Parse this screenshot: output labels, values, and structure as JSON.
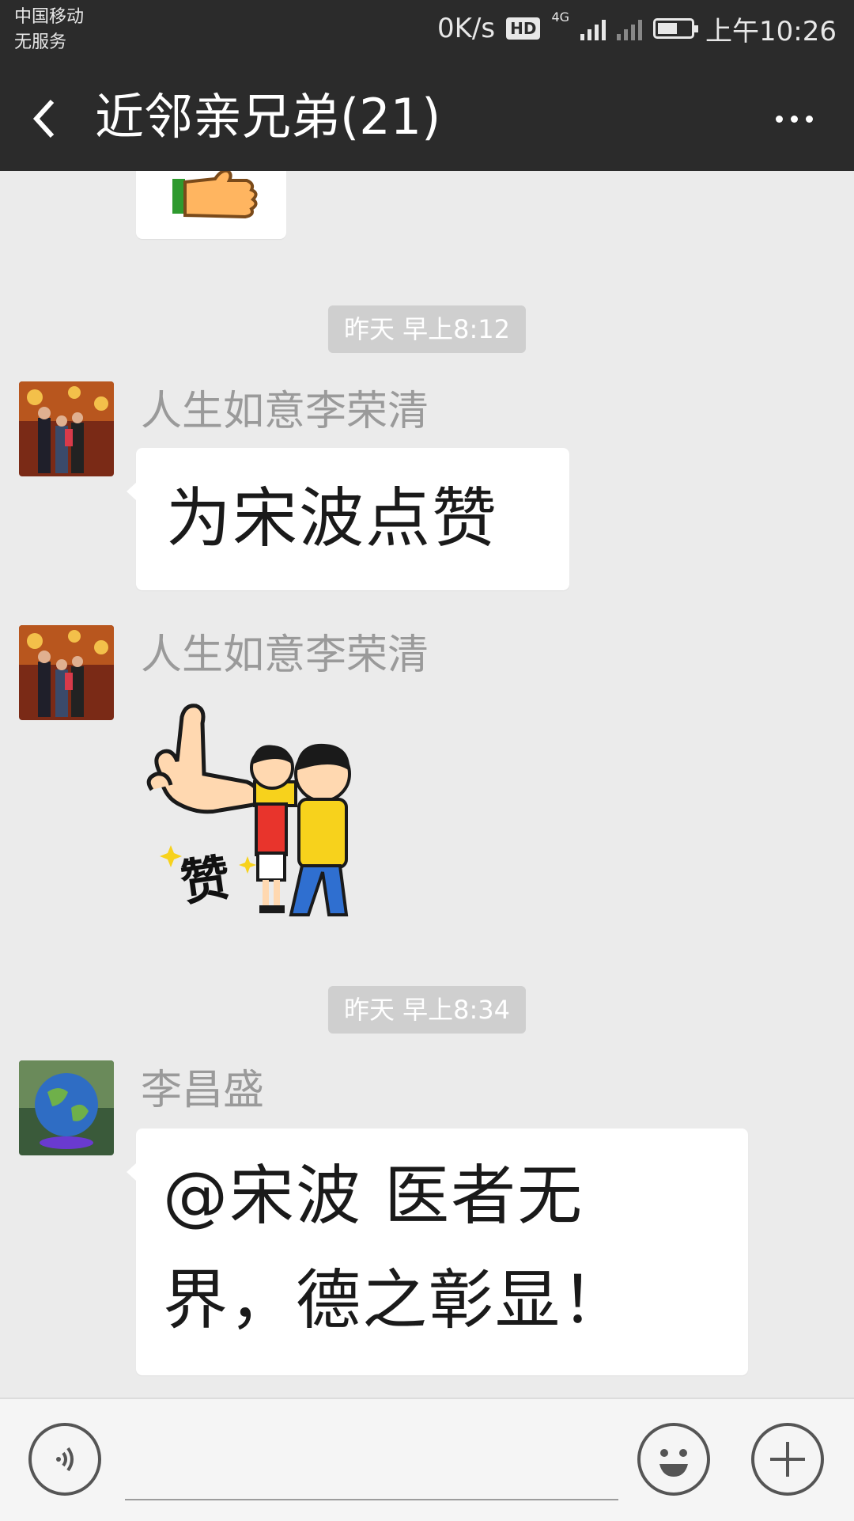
{
  "status_bar": {
    "carrier_line1": "中国移动",
    "carrier_line2": "无服务",
    "speed": "0K/s",
    "hd_badge": "HD",
    "network": "4G",
    "time": "上午10:26"
  },
  "header": {
    "title": "近邻亲兄弟(21)"
  },
  "messages": [
    {
      "type": "timestamp",
      "text": "昨天 早上8:12"
    },
    {
      "type": "text",
      "sender": "人生如意李荣清",
      "text": "为宋波点赞"
    },
    {
      "type": "sticker",
      "sender": "人生如意李荣清",
      "sticker_text": "赞"
    },
    {
      "type": "timestamp",
      "text": "昨天 早上8:34"
    },
    {
      "type": "text",
      "sender": "李昌盛",
      "lines": [
        "@宋波  医者无",
        "界，德之彰显！"
      ]
    }
  ],
  "icons": {
    "back": "back-arrow-icon",
    "more": "more-dots-icon",
    "voice": "voice-input-icon",
    "emoji": "emoji-icon",
    "plus": "plus-icon"
  },
  "colors": {
    "header_bg": "#2b2b2b",
    "chat_bg": "#ebebeb",
    "bubble_bg": "#ffffff",
    "timestamp_bg": "#cfcfcf",
    "sender_name": "#9a9a9a"
  }
}
